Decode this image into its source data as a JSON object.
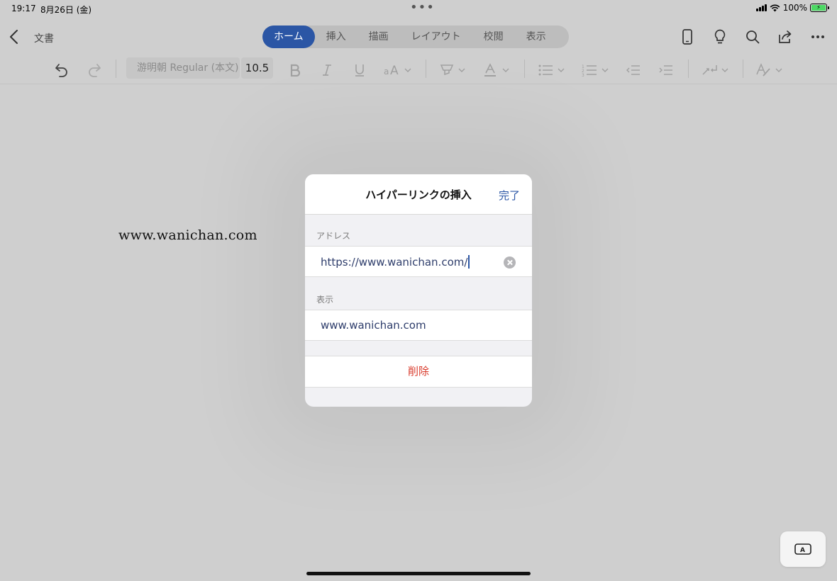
{
  "status": {
    "time": "19:17",
    "date": "8月26日 (金)",
    "battery": "100%",
    "dots": "•••"
  },
  "header": {
    "doc_title": "文書",
    "tabs": [
      {
        "label": "ホーム",
        "active": true
      },
      {
        "label": "挿入"
      },
      {
        "label": "描画"
      },
      {
        "label": "レイアウト"
      },
      {
        "label": "校閲"
      },
      {
        "label": "表示"
      }
    ],
    "icons": [
      "phone-icon",
      "lightbulb-icon",
      "search-icon",
      "share-icon",
      "more-icon"
    ]
  },
  "ribbon": {
    "font_name": "游明朝 Regular (本文)",
    "font_size": "10.5"
  },
  "document": {
    "text": "www.wanichan.com"
  },
  "dialog": {
    "title": "ハイパーリンクの挿入",
    "done_label": "完了",
    "address_label": "アドレス",
    "address_value": "https://www.wanichan.com/",
    "display_label": "表示",
    "display_value": "www.wanichan.com",
    "delete_label": "削除"
  },
  "colors": {
    "accent": "#2b56a5",
    "danger": "#d93a2b"
  }
}
